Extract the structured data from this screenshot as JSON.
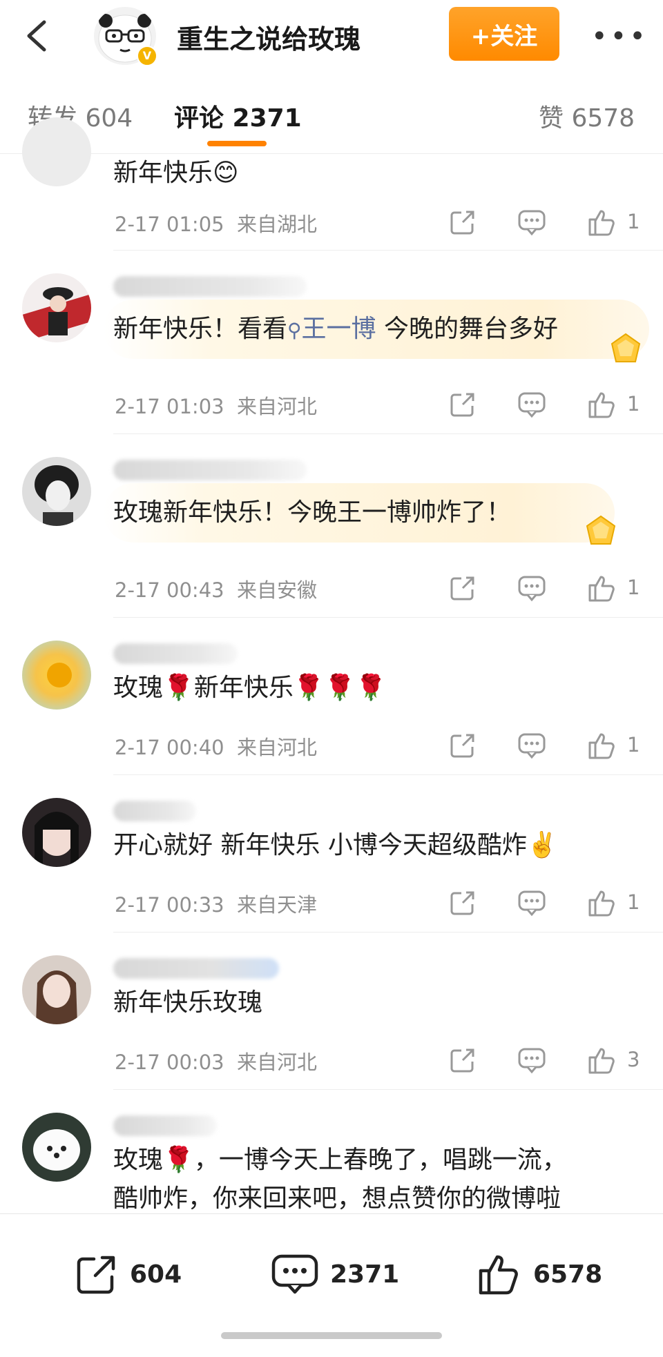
{
  "header": {
    "title": "重生之说给玫瑰",
    "follow_label": "+关注",
    "verified_badge": "V"
  },
  "tabs": [
    {
      "label": "转发 604"
    },
    {
      "label": "评论 2371"
    },
    {
      "label": "赞 6578"
    }
  ],
  "comments": [
    {
      "text": "新年快乐",
      "emoji": "😊",
      "time": "2-17 01:05",
      "location": "来自湖北",
      "likes": "1"
    },
    {
      "text_a": "新年快乐！看看",
      "link": "王一博",
      "text_b": " 今晚的舞台多好",
      "time": "2-17 01:03",
      "location": "来自河北",
      "likes": "1"
    },
    {
      "text": "玫瑰新年快乐！今晚王一博帅炸了！",
      "time": "2-17 00:43",
      "location": "来自安徽",
      "likes": "1"
    },
    {
      "text": "玫瑰🌹新年快乐🌹🌹🌹",
      "time": "2-17 00:40",
      "location": "来自河北",
      "likes": "1"
    },
    {
      "text": "开心就好 新年快乐 小博今天超级酷炸✌️",
      "time": "2-17 00:33",
      "location": "来自天津",
      "likes": "1"
    },
    {
      "text": "新年快乐玫瑰",
      "time": "2-17 00:03",
      "location": "来自河北",
      "likes": "3"
    },
    {
      "line1": "玫瑰🌹，一博今天上春晚了，唱跳一流，",
      "line2": "酷帅炸，你来回来吧，想点赞你的微博啦"
    }
  ],
  "bottom_bar": {
    "reposts": "604",
    "comments": "2371",
    "likes": "6578"
  }
}
